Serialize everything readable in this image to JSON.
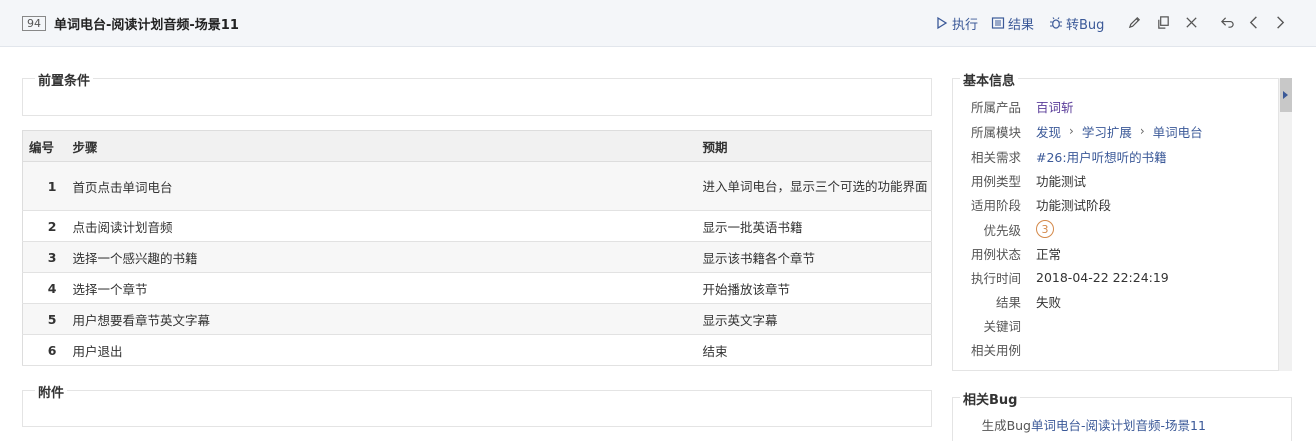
{
  "header": {
    "id": "94",
    "title": "单词电台-阅读计划音频-场景11",
    "actions": {
      "run": "执行",
      "result": "结果",
      "to_bug": "转Bug"
    }
  },
  "precondition": {
    "title": "前置条件"
  },
  "steps": {
    "headers": {
      "no": "编号",
      "step": "步骤",
      "expect": "预期"
    },
    "rows": [
      {
        "no": "1",
        "step": "首页点击单词电台",
        "expect": "进入单词电台，显示三个可选的功能界面"
      },
      {
        "no": "2",
        "step": "点击阅读计划音频",
        "expect": "显示一批英语书籍"
      },
      {
        "no": "3",
        "step": "选择一个感兴趣的书籍",
        "expect": "显示该书籍各个章节"
      },
      {
        "no": "4",
        "step": "选择一个章节",
        "expect": "开始播放该章节"
      },
      {
        "no": "5",
        "step": "用户想要看章节英文字幕",
        "expect": "显示英文字幕"
      },
      {
        "no": "6",
        "step": "用户退出",
        "expect": "结束"
      }
    ]
  },
  "attachments": {
    "title": "附件"
  },
  "basic_info": {
    "title": "基本信息",
    "product_label": "所属产品",
    "product": "百词斩",
    "module_label": "所属模块",
    "module_path": [
      "发现",
      "学习扩展",
      "单词电台"
    ],
    "story_label": "相关需求",
    "story": "#26:用户听想听的书籍",
    "type_label": "用例类型",
    "type": "功能测试",
    "stage_label": "适用阶段",
    "stage": "功能测试阶段",
    "priority_label": "优先级",
    "priority": "3",
    "status_label": "用例状态",
    "status": "正常",
    "exec_time_label": "执行时间",
    "exec_time": "2018-04-22 22:24:19",
    "result_label": "结果",
    "result": "失败",
    "keywords_label": "关键词",
    "keywords": "",
    "related_cases_label": "相关用例",
    "related_cases": ""
  },
  "related_bug": {
    "title": "相关Bug",
    "gen_label": "生成Bug",
    "gen_value": "单词电台-阅读计划音频-场景11"
  },
  "colors": {
    "link": "#3b5998",
    "priority": "#d4894a"
  }
}
